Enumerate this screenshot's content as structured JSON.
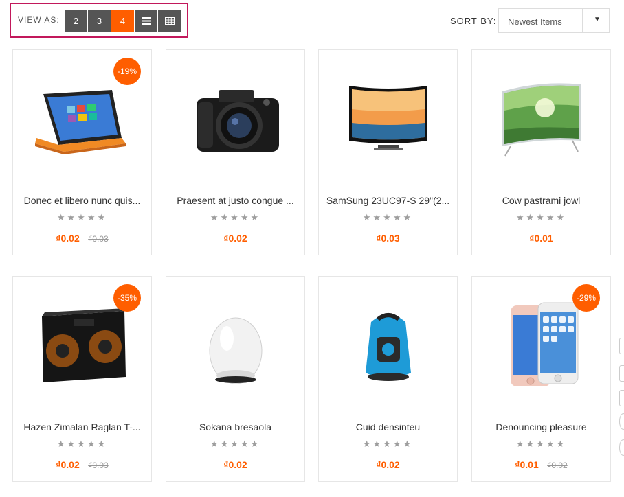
{
  "toolbar": {
    "view_as_label": "VIEW AS:",
    "view_options": [
      "2",
      "3",
      "4"
    ],
    "active_view": "4",
    "sort_label": "SORT BY:",
    "sort_value": "Newest Items"
  },
  "products": [
    {
      "name": "Donec et libero nunc quis...",
      "price": "₫0.02",
      "old_price": "₫0.03",
      "badge": "-19%",
      "image": "laptop-image",
      "stars": "★★★★★"
    },
    {
      "name": "Praesent at justo congue ...",
      "price": "₫0.02",
      "old_price": "",
      "badge": "",
      "image": "camera-image",
      "stars": "★★★★★"
    },
    {
      "name": "SamSung 23UC97-S 29\"(2...",
      "price": "₫0.03",
      "old_price": "",
      "badge": "",
      "image": "curved-tv-image",
      "stars": "★★★★★"
    },
    {
      "name": "Cow pastrami jowl",
      "price": "₫0.01",
      "old_price": "",
      "badge": "",
      "image": "tv-image",
      "stars": "★★★★★"
    },
    {
      "name": "Hazen Zimalan Raglan T-...",
      "price": "₫0.02",
      "old_price": "₫0.03",
      "badge": "-35%",
      "image": "speaker-box-image",
      "stars": "★★★★★"
    },
    {
      "name": "Sokana bresaola",
      "price": "₫0.02",
      "old_price": "",
      "badge": "",
      "image": "egg-speaker-image",
      "stars": "★★★★★"
    },
    {
      "name": "Cuid densinteu",
      "price": "₫0.02",
      "old_price": "",
      "badge": "",
      "image": "vacuum-image",
      "stars": "★★★★★"
    },
    {
      "name": "Denouncing pleasure",
      "price": "₫0.01",
      "old_price": "₫0.02",
      "badge": "-29%",
      "image": "phone-image",
      "stars": "★★★★★"
    }
  ],
  "colors": {
    "accent": "#ff5e00",
    "button_dark": "#555555",
    "highlight_border": "#c2185b"
  }
}
